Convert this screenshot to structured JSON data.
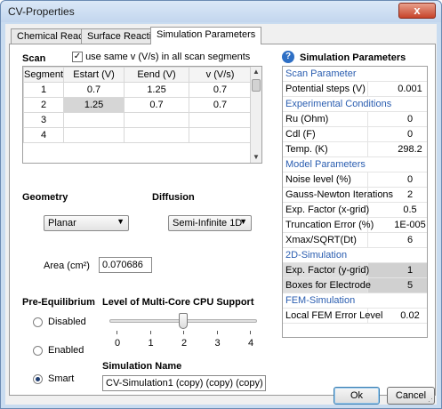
{
  "window": {
    "title": "CV-Properties",
    "close_glyph": "x"
  },
  "tabs": [
    {
      "label": "Chemical Reactions"
    },
    {
      "label": "Surface Reactions"
    },
    {
      "label": "Simulation Parameters"
    }
  ],
  "scan": {
    "label": "Scan",
    "use_same_label": "use same  v (V/s)  in all scan segments",
    "use_same_checked": true,
    "columns": [
      "Segment",
      "Estart (V)",
      "Eend (V)",
      "v (V/s)"
    ],
    "rows": [
      [
        "1",
        "0.7",
        "1.25",
        "0.7"
      ],
      [
        "2",
        "1.25",
        "0.7",
        "0.7"
      ],
      [
        "3",
        "",
        "",
        ""
      ],
      [
        "4",
        "",
        "",
        ""
      ]
    ]
  },
  "geometry": {
    "label": "Geometry",
    "selected": "Planar",
    "area_label": "Area (cm²)",
    "area_value": "0.070686"
  },
  "diffusion": {
    "label": "Diffusion",
    "selected": "Semi-Infinite 1D"
  },
  "pre_equilibrium": {
    "label": "Pre-Equilibrium",
    "options": [
      "Disabled",
      "Enabled",
      "Smart"
    ],
    "selected": "Smart"
  },
  "multicore": {
    "label": "Level of Multi-Core CPU Support",
    "ticks": [
      "0",
      "1",
      "2",
      "3",
      "4"
    ],
    "value": 2
  },
  "simulation_name": {
    "label": "Simulation Name",
    "value": "CV-Simulation1 (copy) (copy) (copy) (copy)"
  },
  "sim_params": {
    "header": "Simulation Parameters",
    "icon": "info-icon",
    "rows": [
      {
        "name": "Scan Parameter",
        "value": "",
        "category": true
      },
      {
        "name": "Potential steps (V)",
        "value": "0.001"
      },
      {
        "name": "Experimental Conditions",
        "value": "",
        "category": true
      },
      {
        "name": "Ru (Ohm)",
        "value": "0"
      },
      {
        "name": "Cdl (F)",
        "value": "0"
      },
      {
        "name": "Temp. (K)",
        "value": "298.2"
      },
      {
        "name": "Model Parameters",
        "value": "",
        "category": true
      },
      {
        "name": "Noise level (%)",
        "value": "0"
      },
      {
        "name": "Gauss-Newton Iterations",
        "value": "2"
      },
      {
        "name": "Exp. Factor (x-grid)",
        "value": "0.5"
      },
      {
        "name": "Truncation Error (%)",
        "value": "1E-005"
      },
      {
        "name": "Xmax/SQRT(Dt)",
        "value": "6"
      },
      {
        "name": "2D-Simulation",
        "value": "",
        "category": true
      },
      {
        "name": "Exp. Factor (y-grid)",
        "value": "1",
        "shaded": true
      },
      {
        "name": "Boxes for Electrode",
        "value": "5",
        "shaded": true
      },
      {
        "name": "FEM-Simulation",
        "value": "",
        "category": true
      },
      {
        "name": "Local FEM Error Level",
        "value": "0.02"
      }
    ]
  },
  "buttons": {
    "ok": "Ok",
    "cancel": "Cancel"
  },
  "colors": {
    "category_text": "#2a5db0",
    "window_frame": "#c9dcf0",
    "close_button": "#c7432a"
  }
}
